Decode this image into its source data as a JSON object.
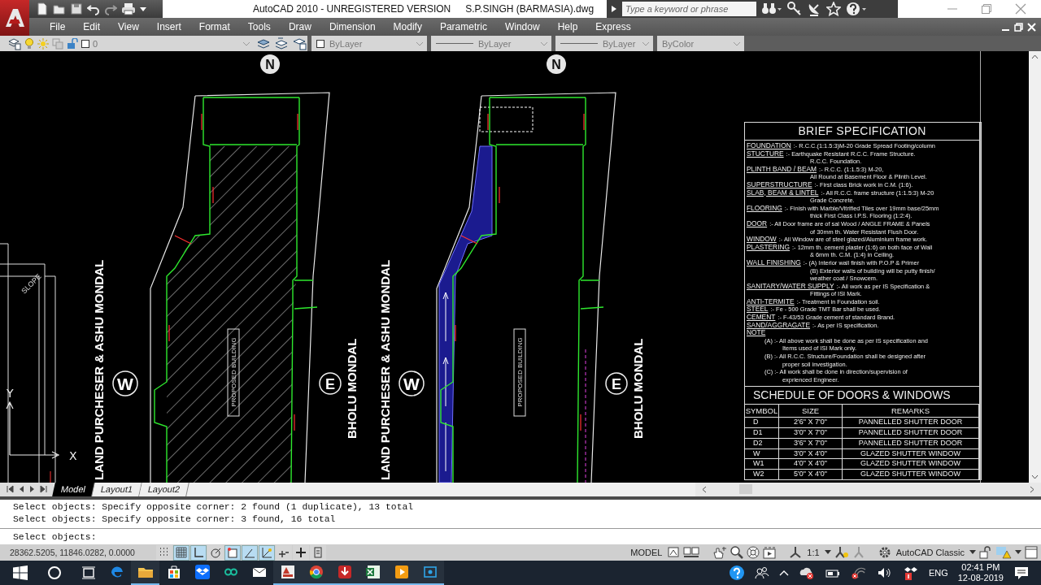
{
  "title_bar": {
    "title": "AutoCAD 2010 - UNREGISTERED VERSION",
    "file": "S.P.SINGH (BARMASIA).dwg",
    "search_placeholder": "Type a keyword or phrase"
  },
  "menu": [
    "File",
    "Edit",
    "View",
    "Insert",
    "Format",
    "Tools",
    "Draw",
    "Dimension",
    "Modify",
    "Parametric",
    "Window",
    "Help",
    "Express"
  ],
  "layer_toolbar": {
    "layer": "0",
    "color_setting": "ByLayer",
    "linetype": "ByLayer",
    "lineweight": "ByLayer",
    "plot_style": "ByColor"
  },
  "drawing": {
    "plots": [
      {
        "kind": "hatched",
        "north": "N",
        "west": "W",
        "east": "E",
        "west_owner": "LAND PURCHESER & ASHU MONDAL",
        "east_owner": "BHOLU MONDAL",
        "building": "PROPOSED BUILDING"
      },
      {
        "kind": "filled",
        "north": "N",
        "west": "W",
        "east": "E",
        "west_owner": "LAND PURCHESER & ASHU MONDAL",
        "east_owner": "BHOLU MONDAL",
        "building": "PROPOSED BUILDING"
      }
    ],
    "side_note": "SLOPE",
    "ucs": {
      "x": "X",
      "y": "Y"
    }
  },
  "specification": {
    "title": "BRIEF SPECIFICATION",
    "items": [
      {
        "label": "FOUNDATION",
        "lines": [
          ":- R.C.C.(1:1.5:3)M-20 Grade Spread Footing/column"
        ]
      },
      {
        "label": "STUCTURE",
        "lines": [
          ":- Earthquake Resistant R.C.C. Frame Structure.",
          "R.C.C. Foundation."
        ]
      },
      {
        "label": "PLINTH BAND / BEAM",
        "lines": [
          ":- R.C.C. (1:1.5:3) M-20,",
          "All Round at Basement Floor & Plinth Level."
        ]
      },
      {
        "label": "SUPERSTRUCTURE",
        "lines": [
          ":- First class Brick work in C.M. (1:6)."
        ]
      },
      {
        "label": "SLAB, BEAM & LINTEL",
        "lines": [
          ":- All R.C.C. frame structure (1:1.5:3) M-20",
          "Grade Concrete."
        ]
      },
      {
        "label": "FLOORING",
        "lines": [
          ":- Finish with Marble/Vitrified Tiles over 19mm base/25mm",
          "thick First Class I.P.S. Flooring (1:2:4)."
        ]
      },
      {
        "label": "DOOR",
        "lines": [
          ":- All Door frame are of sal Wood / ANGLE FRAME & Panels",
          "of 30mm th. Water Resistant Flush Door."
        ]
      },
      {
        "label": "WINDOW",
        "lines": [
          ":- All Window are of steel glazed/Aluminium frame work."
        ]
      },
      {
        "label": "PLASTERING",
        "lines": [
          ":- 12mm th. cement plaster (1:6) on both face of Wall",
          "& 6mm th. C.M. (1:4) in Ceiling."
        ]
      },
      {
        "label": "WALL FINISHING",
        "lines": [
          ":- (A) Interior wall finish with P.O.P & Primer",
          "(B) Exterior walls of building will be putty finish/",
          "weather coat / Snowcem."
        ]
      },
      {
        "label": "SANITARY/WATER SUPPLY",
        "lines": [
          ":- All work as per IS Specification &",
          "Fittings of ISI Mark."
        ]
      },
      {
        "label": "ANTI-TERMITE",
        "lines": [
          ":- Treatment in Foundation soil."
        ]
      },
      {
        "label": "STEEL",
        "lines": [
          ":- Fe - 500 Grade TMT Bar shall be used."
        ]
      },
      {
        "label": "CEMENT",
        "lines": [
          ":- F-43/53 Grade cement of standard Brand."
        ]
      },
      {
        "label": "SAND/AGGRAGATE",
        "lines": [
          ":- As per IS specification."
        ]
      }
    ],
    "note_label": "NOTE",
    "notes": [
      {
        "lines": [
          "(A) :- All above work shall be done as per IS specification and",
          "Items used of ISI Mark only."
        ]
      },
      {
        "lines": [
          "(B) :- All R.C.C. Structure/Foundation shall be designed after",
          "proper soil investigation."
        ]
      },
      {
        "lines": [
          "(C) :- All work shall be done in direction/supervision of",
          "exprienced Engineer."
        ]
      }
    ]
  },
  "schedule": {
    "title": "SCHEDULE OF DOORS & WINDOWS",
    "columns": [
      "SYMBOL",
      "SIZE",
      "REMARKS"
    ],
    "rows": [
      [
        "D",
        "2'6\" X 7'0\"",
        "PANNELLED SHUTTER DOOR"
      ],
      [
        "D1",
        "3'0\" X 7'0\"",
        "PANNELLED SHUTTER DOOR"
      ],
      [
        "D2",
        "3'6\" X 7'0\"",
        "PANNELLED SHUTTER DOOR"
      ],
      [
        "W",
        "3'0\" X 4'0\"",
        "GLAZED SHUTTER WINDOW"
      ],
      [
        "W1",
        "4'0\" X 4'0\"",
        "GLAZED SHUTTER WINDOW"
      ],
      [
        "W2",
        "5'0\" X 4'0\"",
        "GLAZED SHUTTER WINDOW"
      ]
    ]
  },
  "layout_tabs": [
    {
      "label": "Model",
      "selected": true
    },
    {
      "label": "Layout1",
      "selected": false
    },
    {
      "label": "Layout2",
      "selected": false
    }
  ],
  "command_history": [
    "Select objects: Specify opposite corner: 2 found (1 duplicate), 13 total",
    "Select objects: Specify opposite corner: 3 found, 16 total"
  ],
  "command_prompt": "Select objects:",
  "status_bar": {
    "coordinates": "28362.5205, 11846.0282, 0.0000",
    "toggles": [
      {
        "kind": "snap",
        "on": false
      },
      {
        "kind": "grid",
        "on": true
      },
      {
        "kind": "ortho",
        "on": true
      },
      {
        "kind": "polar",
        "on": false
      },
      {
        "kind": "osnap",
        "on": true
      },
      {
        "kind": "otrack",
        "on": true
      },
      {
        "kind": "ducs",
        "on": true
      },
      {
        "kind": "dyn",
        "on": false
      },
      {
        "kind": "lwt",
        "on": false
      },
      {
        "kind": "qp",
        "on": false
      }
    ],
    "space": "MODEL",
    "annotation_scale": "1:1",
    "workspace": "AutoCAD Classic"
  },
  "taskbar": {
    "apps": [
      {
        "kind": "edge",
        "running": false
      },
      {
        "kind": "explorer",
        "running": true
      },
      {
        "kind": "store",
        "running": false
      },
      {
        "kind": "dropbox",
        "running": false
      },
      {
        "kind": "infinity",
        "running": false
      },
      {
        "kind": "mail",
        "running": false
      },
      {
        "kind": "autocad",
        "running": true
      },
      {
        "kind": "chrome",
        "running": true
      },
      {
        "kind": "download",
        "running": true
      },
      {
        "kind": "excel",
        "running": true
      },
      {
        "kind": "player",
        "running": true
      },
      {
        "kind": "capture",
        "running": true
      }
    ],
    "language": "ENG",
    "time": "02:41 PM",
    "date": "12-08-2019"
  }
}
